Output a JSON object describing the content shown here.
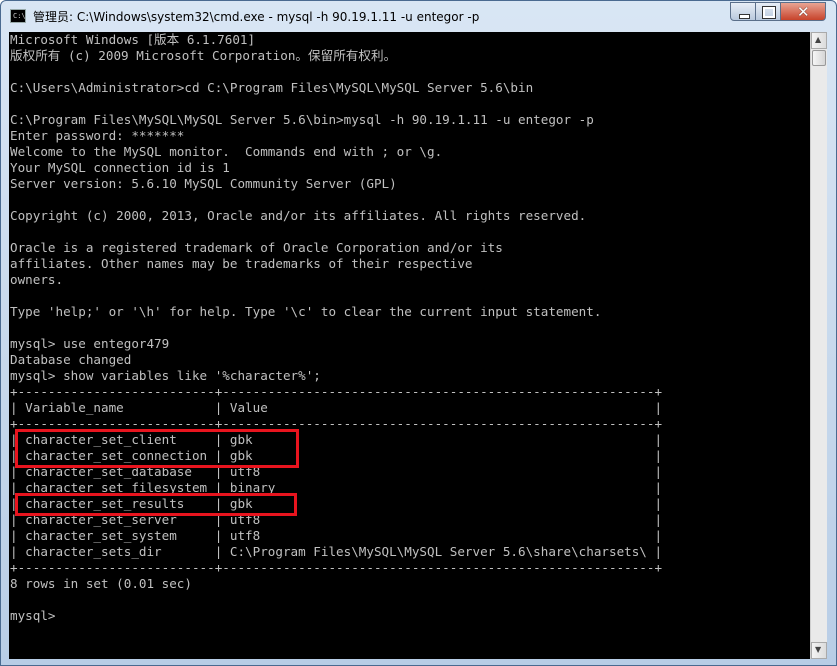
{
  "window": {
    "title": "管理员: C:\\Windows\\system32\\cmd.exe - mysql  -h 90.19.1.11 -u entegor -p",
    "icon_label": "C:\\",
    "icon_name": "cmd-icon",
    "buttons": {
      "minimize": "minimize-icon",
      "maximize": "maximize-icon",
      "close": "close-icon"
    }
  },
  "console": {
    "lines": [
      "Microsoft Windows [版本 6.1.7601]",
      "版权所有 (c) 2009 Microsoft Corporation。保留所有权利。",
      "",
      "C:\\Users\\Administrator>cd C:\\Program Files\\MySQL\\MySQL Server 5.6\\bin",
      "",
      "C:\\Program Files\\MySQL\\MySQL Server 5.6\\bin>mysql -h 90.19.1.11 -u entegor -p",
      "Enter password: *******",
      "Welcome to the MySQL monitor.  Commands end with ; or \\g.",
      "Your MySQL connection id is 1",
      "Server version: 5.6.10 MySQL Community Server (GPL)",
      "",
      "Copyright (c) 2000, 2013, Oracle and/or its affiliates. All rights reserved.",
      "",
      "Oracle is a registered trademark of Oracle Corporation and/or its",
      "affiliates. Other names may be trademarks of their respective",
      "owners.",
      "",
      "Type 'help;' or '\\h' for help. Type '\\c' to clear the current input statement.",
      "",
      "mysql> use entegor479",
      "Database changed",
      "mysql> show variables like '%character%';",
      "+--------------------------+---------------------------------------------------------+",
      "| Variable_name            | Value                                                   |",
      "+--------------------------+---------------------------------------------------------+",
      "| character_set_client     | gbk                                                     |",
      "| character_set_connection | gbk                                                     |",
      "| character_set_database   | utf8                                                    |",
      "| character_set_filesystem | binary                                                  |",
      "| character_set_results    | gbk                                                     |",
      "| character_set_server     | utf8                                                    |",
      "| character_set_system     | utf8                                                    |",
      "| character_sets_dir       | C:\\Program Files\\MySQL\\MySQL Server 5.6\\share\\charsets\\ |",
      "+--------------------------+---------------------------------------------------------+",
      "8 rows in set (0.01 sec)",
      "",
      "mysql>"
    ]
  },
  "annotations": {
    "highlight_color": "#e8141e"
  }
}
